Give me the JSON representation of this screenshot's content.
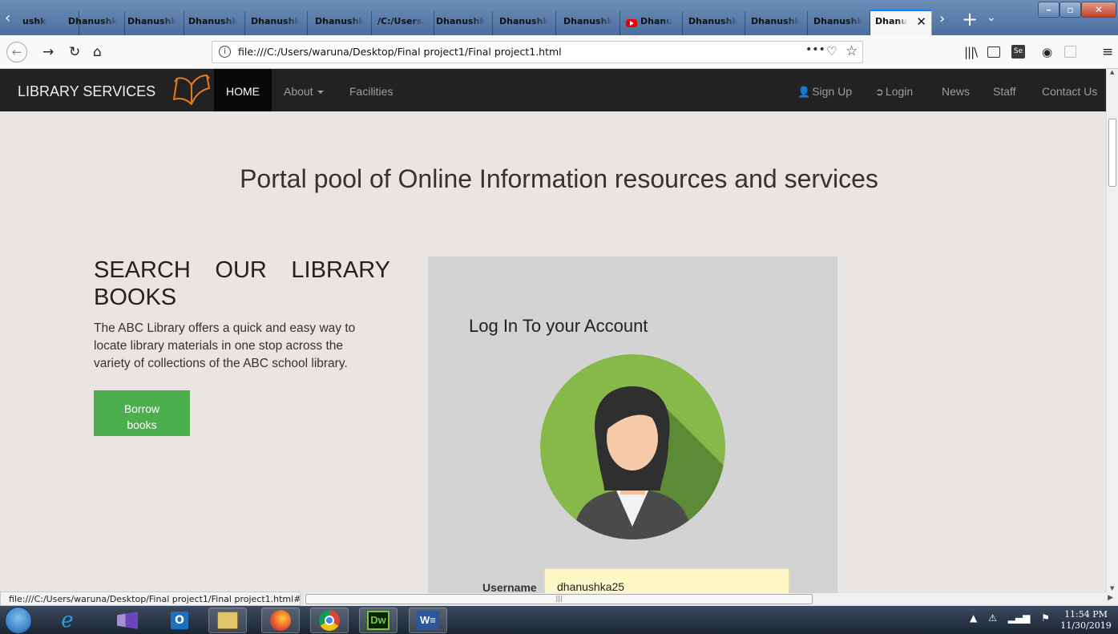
{
  "browser": {
    "tabs": [
      {
        "label": "ushk",
        "active": false
      },
      {
        "label": "Dhanushk",
        "active": false
      },
      {
        "label": "Dhanushk",
        "active": false
      },
      {
        "label": "Dhanushk",
        "active": false
      },
      {
        "label": "Dhanushk",
        "active": false
      },
      {
        "label": "Dhanushk",
        "active": false
      },
      {
        "label": "/C:/Users/",
        "active": false
      },
      {
        "label": "Dhanushk",
        "active": false
      },
      {
        "label": "Dhanushk",
        "active": false
      },
      {
        "label": "Dhanushk",
        "active": false
      },
      {
        "label": "Dhanu",
        "active": false,
        "icon": "youtube-icon"
      },
      {
        "label": "Dhanushk",
        "active": false
      },
      {
        "label": "Dhanushk",
        "active": false
      },
      {
        "label": "Dhanushk",
        "active": false
      },
      {
        "label": "Dhanu",
        "active": true
      }
    ],
    "url": "file:///C:/Users/waruna/Desktop/Final project1/Final project1.html",
    "status_url": "file:///C:/Users/waruna/Desktop/Final project1/Final project1.html#",
    "accent_color": "#0a84ff"
  },
  "navbar": {
    "brand": "LIBRARY SERVICES",
    "home": "HOME",
    "about": "About",
    "facilities": "Facilities",
    "signup": "Sign Up",
    "login": "Login",
    "news": "News",
    "staff": "Staff",
    "contact": "Contact Us",
    "logo_color": "#e87a1e"
  },
  "page": {
    "heading": "Portal pool of Online Information resources and services",
    "search_title": "SEARCH OUR LIBRARY BOOKS",
    "search_description": "The ABC Library offers a quick and easy way to locate library materials in one stop across the variety of collections of the ABC school library.",
    "borrow_button": "Borrow books",
    "button_color": "#4cae4c"
  },
  "login": {
    "title": "Log In To your Account",
    "username_label": "Username",
    "username_value": "dhanushka25"
  },
  "taskbar": {
    "time": "11:54 PM",
    "date": "11/30/2019",
    "apps": [
      "internet-explorer-icon",
      "visual-studio-icon",
      "outlook-icon",
      "file-explorer-icon",
      "firefox-icon",
      "chrome-icon",
      "dreamweaver-icon",
      "word-icon"
    ]
  }
}
